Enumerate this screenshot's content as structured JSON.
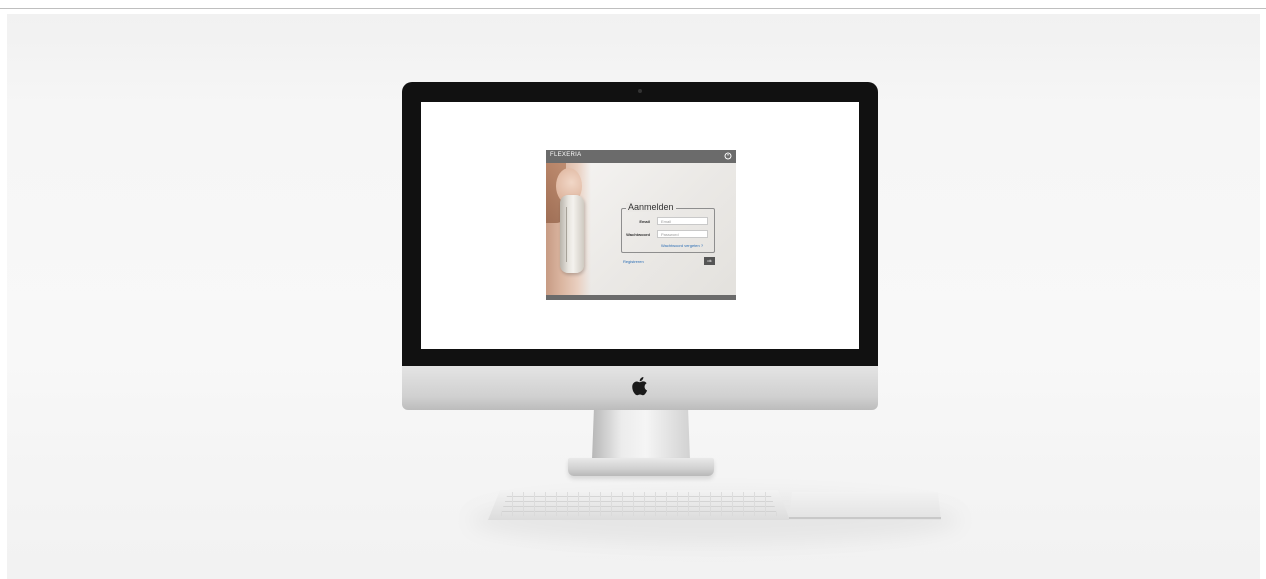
{
  "login": {
    "brand": "FLEXERIA",
    "title": "Aanmelden",
    "email_label": "Email",
    "email_placeholder": "Email",
    "password_label": "Wachtwoord",
    "password_placeholder": "Password",
    "forgot_link": "Wachtwoord vergeten ?",
    "register_link": "Registreren",
    "ok_button": "ok"
  },
  "icons": {
    "logout": "logout-icon",
    "device_logo": "apple-logo-icon"
  }
}
